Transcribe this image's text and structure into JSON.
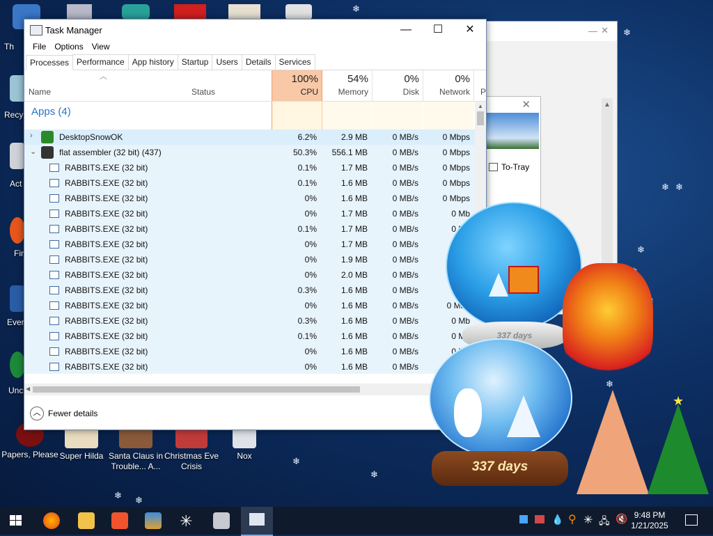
{
  "window": {
    "title": "Task Manager",
    "minimize": "—",
    "maximize": "☐",
    "close": "✕"
  },
  "menu": [
    "File",
    "Options",
    "View"
  ],
  "tabs": [
    "Processes",
    "Performance",
    "App history",
    "Startup",
    "Users",
    "Details",
    "Services"
  ],
  "columns": {
    "name": "Name",
    "status": "Status",
    "cpu": {
      "pct": "100%",
      "label": "CPU"
    },
    "memory": {
      "pct": "54%",
      "label": "Memory"
    },
    "disk": {
      "pct": "0%",
      "label": "Disk"
    },
    "network": {
      "pct": "0%",
      "label": "Network"
    },
    "power": "P"
  },
  "group": {
    "label": "Apps (4)"
  },
  "apps": [
    {
      "name": "DesktopSnowOK",
      "cpu": "6.2%",
      "mem": "2.9 MB",
      "disk": "0 MB/s",
      "net": "0 Mbps"
    },
    {
      "name": "flat assembler (32 bit) (437)",
      "cpu": "50.3%",
      "mem": "556.1 MB",
      "disk": "0 MB/s",
      "net": "0 Mbps"
    }
  ],
  "processes": [
    {
      "name": "RABBITS.EXE (32 bit)",
      "cpu": "0.1%",
      "mem": "1.7 MB",
      "disk": "0 MB/s",
      "net": "0 Mbps"
    },
    {
      "name": "RABBITS.EXE (32 bit)",
      "cpu": "0.1%",
      "mem": "1.6 MB",
      "disk": "0 MB/s",
      "net": "0 Mbps"
    },
    {
      "name": "RABBITS.EXE (32 bit)",
      "cpu": "0%",
      "mem": "1.6 MB",
      "disk": "0 MB/s",
      "net": "0 Mbps"
    },
    {
      "name": "RABBITS.EXE (32 bit)",
      "cpu": "0%",
      "mem": "1.7 MB",
      "disk": "0 MB/s",
      "net": "0 Mb"
    },
    {
      "name": "RABBITS.EXE (32 bit)",
      "cpu": "0.1%",
      "mem": "1.7 MB",
      "disk": "0 MB/s",
      "net": "0 Mb"
    },
    {
      "name": "RABBITS.EXE (32 bit)",
      "cpu": "0%",
      "mem": "1.7 MB",
      "disk": "0 MB/s",
      "net": "0 M"
    },
    {
      "name": "RABBITS.EXE (32 bit)",
      "cpu": "0%",
      "mem": "1.9 MB",
      "disk": "0 MB/s",
      "net": "0 M"
    },
    {
      "name": "RABBITS.EXE (32 bit)",
      "cpu": "0%",
      "mem": "2.0 MB",
      "disk": "0 MB/s",
      "net": "0 Mb"
    },
    {
      "name": "RABBITS.EXE (32 bit)",
      "cpu": "0.3%",
      "mem": "1.6 MB",
      "disk": "0 MB/s",
      "net": "0 Mb"
    },
    {
      "name": "RABBITS.EXE (32 bit)",
      "cpu": "0%",
      "mem": "1.6 MB",
      "disk": "0 MB/s",
      "net": "0 Mbp"
    },
    {
      "name": "RABBITS.EXE (32 bit)",
      "cpu": "0.3%",
      "mem": "1.6 MB",
      "disk": "0 MB/s",
      "net": "0 Mb"
    },
    {
      "name": "RABBITS.EXE (32 bit)",
      "cpu": "0.1%",
      "mem": "1.6 MB",
      "disk": "0 MB/s",
      "net": "0 Mb"
    },
    {
      "name": "RABBITS.EXE (32 bit)",
      "cpu": "0%",
      "mem": "1.6 MB",
      "disk": "0 MB/s",
      "net": "0 Mb"
    },
    {
      "name": "RABBITS.EXE (32 bit)",
      "cpu": "0%",
      "mem": "1.6 MB",
      "disk": "0 MB/s",
      "net": ""
    }
  ],
  "footer": {
    "fewer_details": "Fewer details"
  },
  "back_window": {
    "to_tray": "To-Tray"
  },
  "desktop_icons": [
    {
      "label": "Papers, Please",
      "color": "#7a1010"
    },
    {
      "label": "Super Hilda",
      "color": "#e9dcc0"
    },
    {
      "label": "Santa Claus in Trouble... A...",
      "color": "#8a5a3a"
    },
    {
      "label": "Christmas Eve Crisis",
      "color": "#c23b3b"
    },
    {
      "label": "Nox",
      "color": "#dfe3e8"
    }
  ],
  "left_labels": [
    "Th",
    "Recy",
    "Act",
    "Fir",
    "Ever",
    "Unc"
  ],
  "globe_text": {
    "top": "337 days",
    "bottom": "337 days"
  },
  "clock": {
    "time": "9:48 PM",
    "date": "1/21/2025"
  }
}
